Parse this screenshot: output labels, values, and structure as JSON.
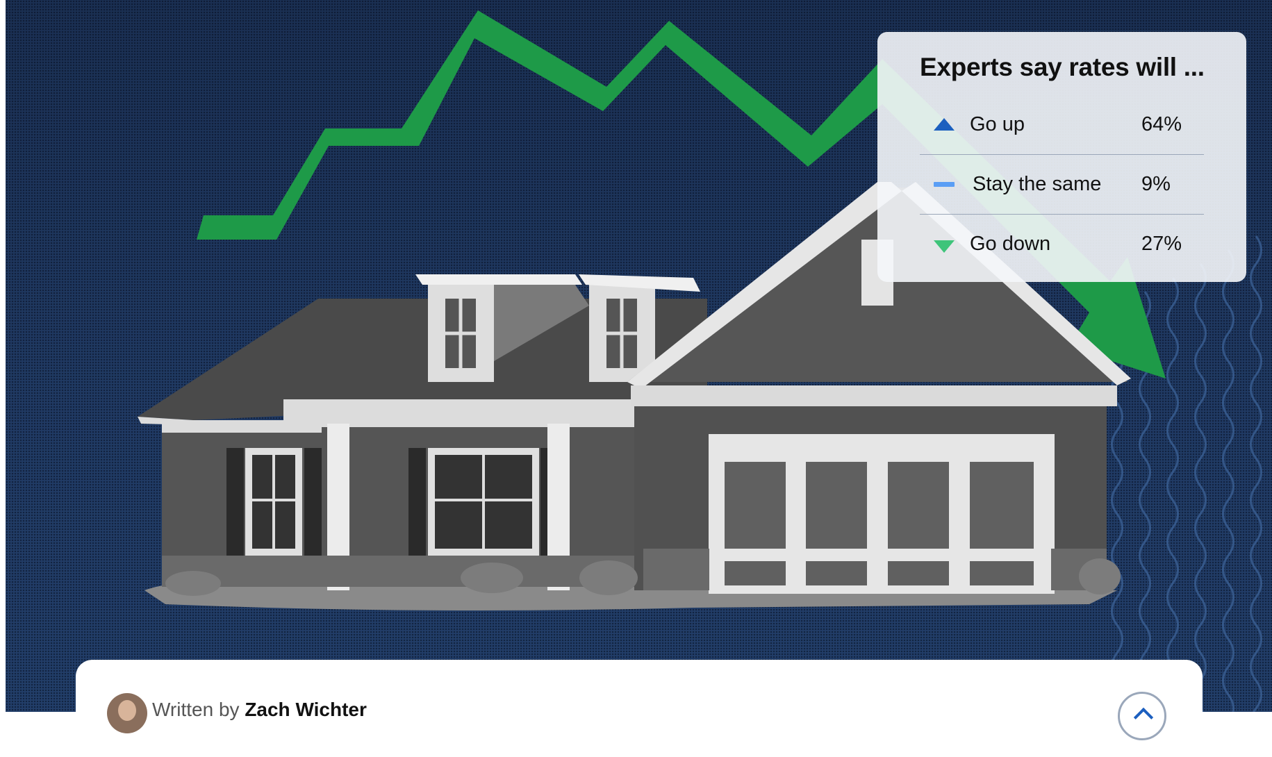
{
  "legend": {
    "title": "Experts say rates will ...",
    "rows": [
      {
        "label": "Go up",
        "value": "64%",
        "icon": "up-triangle-icon",
        "color": "#1c5fbf"
      },
      {
        "label": "Stay the same",
        "value": "9%",
        "icon": "dash-icon",
        "color": "#5a9ef5"
      },
      {
        "label": "Go down",
        "value": "27%",
        "icon": "down-triangle-icon",
        "color": "#3ec47a"
      }
    ]
  },
  "author": {
    "prefix": "Written by",
    "name": "Zach Wichter"
  },
  "colors": {
    "background": "#1c3358",
    "arrow": "#1e9a48"
  }
}
